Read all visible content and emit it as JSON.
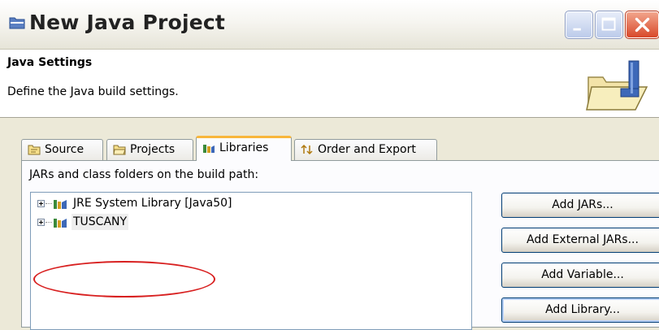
{
  "window": {
    "title": "New Java Project",
    "controls": [
      "minimize-icon",
      "maximize-icon",
      "close-icon"
    ]
  },
  "header": {
    "title": "Java Settings",
    "description": "Define the Java build settings."
  },
  "tabs": [
    {
      "label": "Source",
      "icon": "source-folder-icon",
      "active": false
    },
    {
      "label": "Projects",
      "icon": "projects-folder-icon",
      "active": false
    },
    {
      "label": "Libraries",
      "icon": "libraries-icon",
      "active": true
    },
    {
      "label": "Order and Export",
      "icon": "order-export-icon",
      "active": false
    }
  ],
  "libraries": {
    "list_label": "JARs and class folders on the build path:",
    "items": [
      {
        "label": "JRE System Library [Java50]",
        "icon": "library-icon"
      },
      {
        "label": "TUSCANY",
        "icon": "library-icon",
        "selected": true,
        "annotated": true
      }
    ],
    "buttons": [
      "Add JARs...",
      "Add External JARs...",
      "Add Variable...",
      "Add Library..."
    ]
  },
  "colors": {
    "title_bar": "#f6f5f0",
    "dialog_bg": "#ece9d8",
    "active_tab_accent": "#f8b63c",
    "annotation": "#d82020",
    "button_border": "#003c74"
  }
}
